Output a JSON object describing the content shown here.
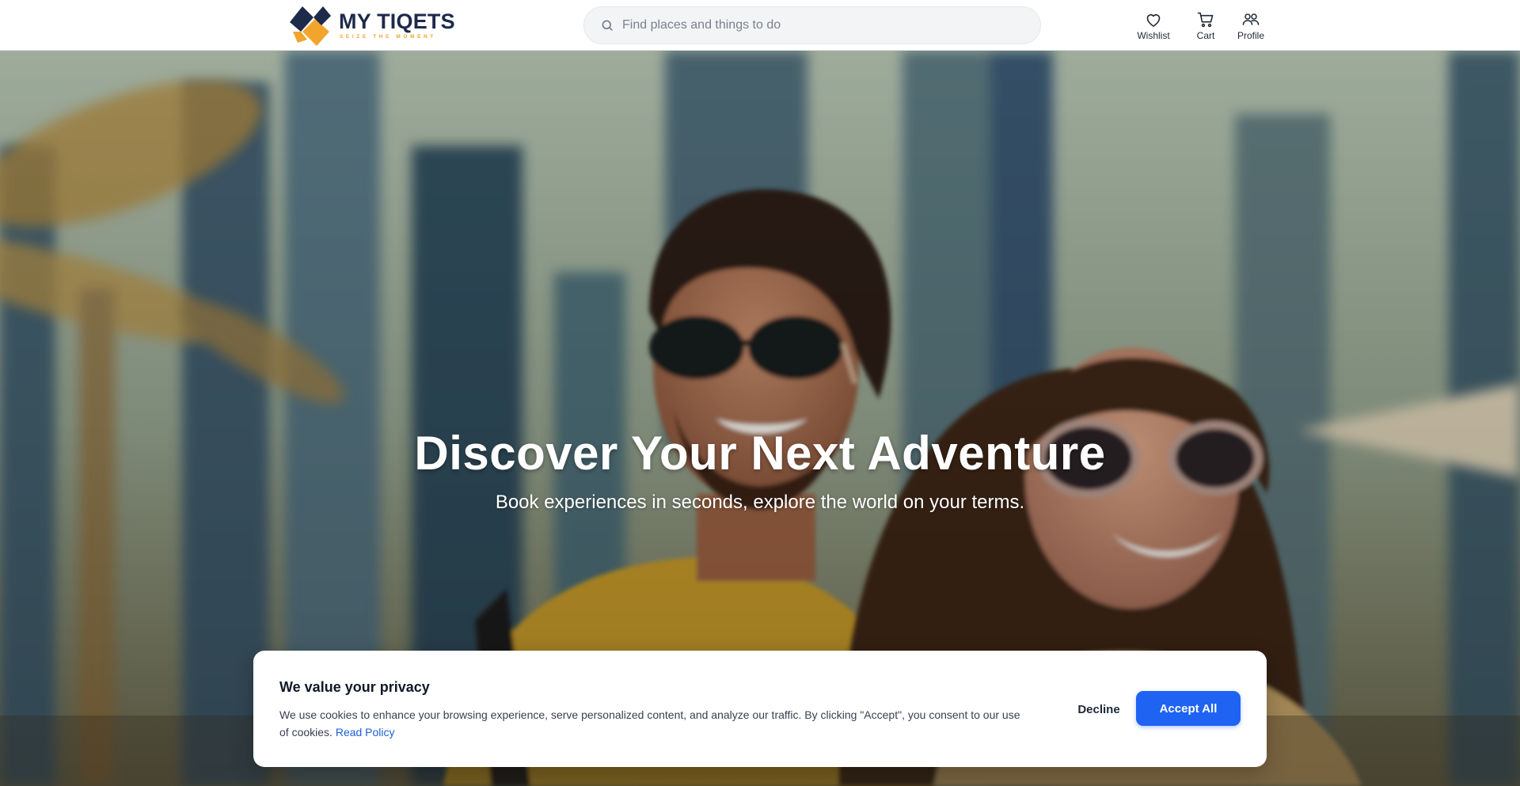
{
  "brand": {
    "name": "MY TIQETS",
    "tagline": "SEIZE THE MOMENT",
    "colors": {
      "navy": "#1d2a4a",
      "orange": "#f2a52d"
    }
  },
  "search": {
    "placeholder": "Find places and things to do",
    "value": "",
    "icon": "search-icon"
  },
  "nav": {
    "wishlist": {
      "label": "Wishlist",
      "icon": "heart-icon"
    },
    "cart": {
      "label": "Cart",
      "icon": "cart-icon"
    },
    "profile": {
      "label": "Profile",
      "icon": "users-icon"
    }
  },
  "hero": {
    "title": "Discover Your Next Adventure",
    "subtitle": "Book experiences in seconds, explore the world on your terms."
  },
  "cookie_banner": {
    "title": "We value your privacy",
    "title_glyph": "",
    "body": "We use cookies to enhance your browsing experience, serve personalized content, and analyze our traffic. By clicking \"Accept\", you consent to our use of cookies.",
    "link_label": "Read Policy",
    "decline_label": "Decline",
    "accept_label": "Accept All",
    "accent_color": "#1f63f2"
  }
}
